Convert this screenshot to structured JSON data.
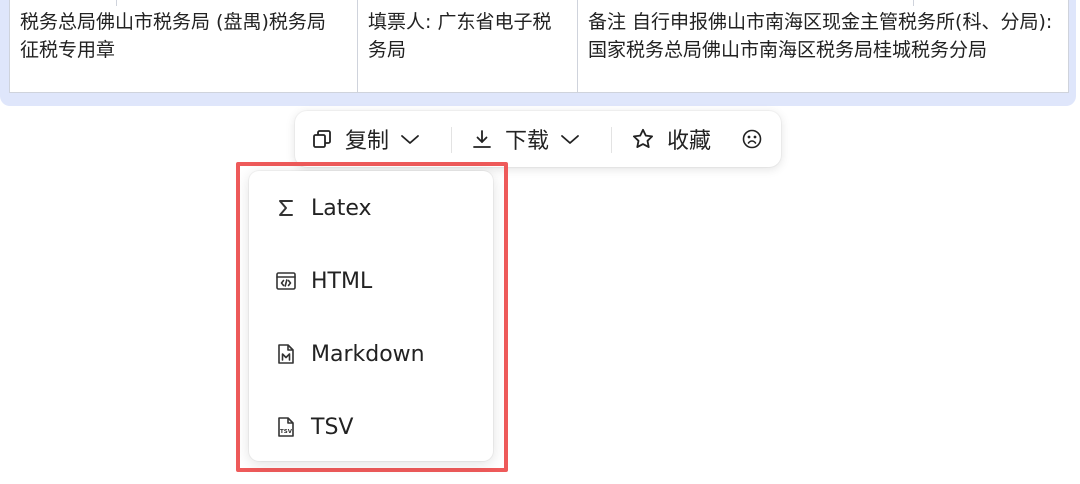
{
  "table": {
    "cells": [
      "税务总局佛山市税务局 (盘禺)税务局 征税专用章",
      "填票人: 广东省电子税务局",
      "备注 自行申报佛山市南海区现金主管税务所(科、分局):国家税务总局佛山市南海区税务局桂城税务分局"
    ]
  },
  "toolbar": {
    "copy_label": "复制",
    "download_label": "下载",
    "favorite_label": "收藏"
  },
  "menu": {
    "items": [
      {
        "label": "Latex",
        "icon": "sigma-icon"
      },
      {
        "label": "HTML",
        "icon": "code-window-icon"
      },
      {
        "label": "Markdown",
        "icon": "markdown-file-icon"
      },
      {
        "label": "TSV",
        "icon": "tsv-file-icon"
      }
    ]
  },
  "colors": {
    "highlight_border": "#ee5a5a",
    "table_frame": "#dfe6fb"
  }
}
